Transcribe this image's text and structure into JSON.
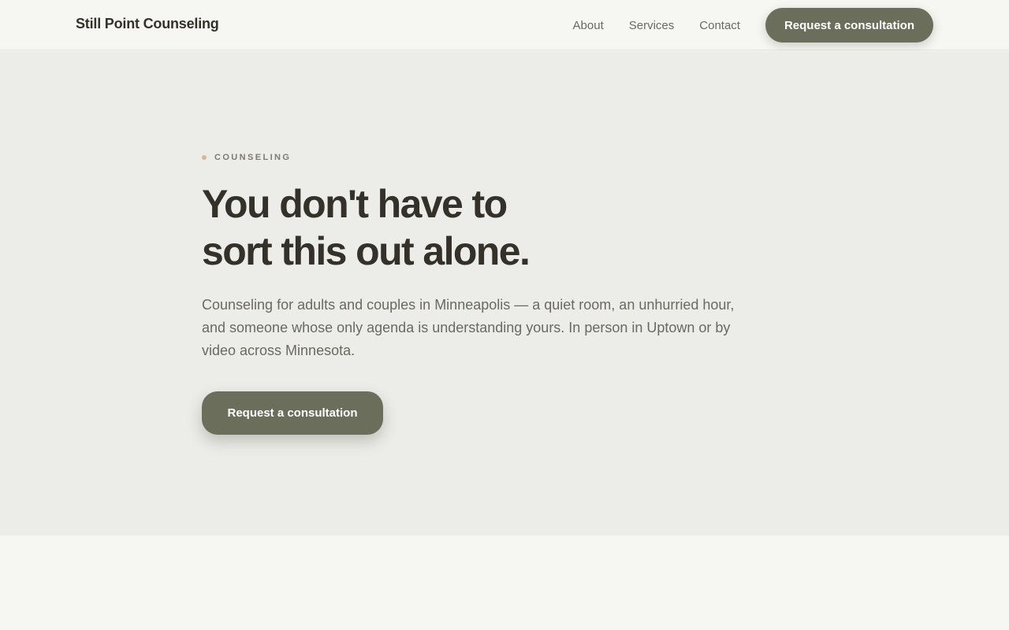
{
  "header": {
    "brand": "Still Point Counseling",
    "nav": {
      "about": "About",
      "services": "Services",
      "contact": "Contact"
    },
    "cta_label": "Request a consultation"
  },
  "hero": {
    "eyebrow": "COUNSELING",
    "headline_line1": "You don't have to",
    "headline_line2": "sort this out alone.",
    "lead": "Counseling for adults and couples in Minneapolis — a quiet room, an unhurried hour, and someone whose only agenda is understanding yours. In person in Uptown or by video across Minnesota.",
    "cta_label": "Request a consultation"
  },
  "colors": {
    "accent": "#6b6e5b",
    "hero_background": "#ececE8",
    "page_background": "#f6f6f2",
    "eyebrow_dot": "#d4b89a",
    "text_primary": "#33312a",
    "text_secondary": "#6a6a62"
  }
}
